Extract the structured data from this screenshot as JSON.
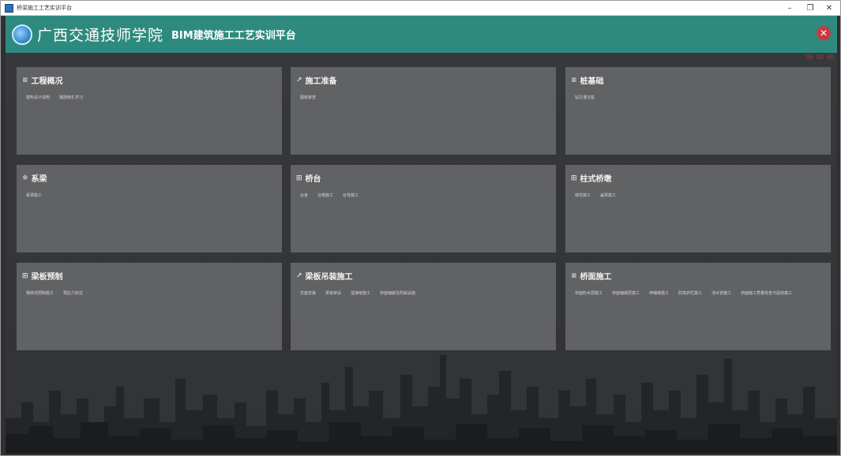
{
  "window": {
    "title": "桥梁施工工艺实训平台"
  },
  "header": {
    "school": "广西交通技师学院",
    "platform": "BIM建筑施工工艺实训平台"
  },
  "cards": [
    {
      "icon": "≡",
      "title": "工程概况",
      "items": [
        "建构设计说明",
        "钢筋绑扎学习"
      ]
    },
    {
      "icon": "↗",
      "title": "施工准备",
      "items": [
        "图纸审查"
      ]
    },
    {
      "icon": "≡",
      "title": "桩基础",
      "items": [
        "钻孔灌注桩"
      ]
    },
    {
      "icon": "❄",
      "title": "系梁",
      "items": [
        "系梁施工"
      ]
    },
    {
      "icon": "⊞",
      "title": "桥台",
      "items": [
        "台身",
        "台帽施工",
        "台背施工"
      ]
    },
    {
      "icon": "⊞",
      "title": "柱式桥墩",
      "items": [
        "墩柱施工",
        "盖梁施工"
      ]
    },
    {
      "icon": "⊞",
      "title": "梁板预制",
      "items": [
        "钢绞线预制施工",
        "预应力张拉"
      ]
    },
    {
      "icon": "↗",
      "title": "梁板吊装施工",
      "items": [
        "支座安装",
        "梁板架设",
        "湿接缝施工",
        "桥面铺装及附属设施"
      ]
    },
    {
      "icon": "≡",
      "title": "桥面施工",
      "items": [
        "桥面防水层施工",
        "桥面铺装层施工",
        "伸缩缝施工",
        "防撞护栏施工",
        "泄水管施工",
        "桥面施工质量检查与验收施工"
      ]
    }
  ]
}
